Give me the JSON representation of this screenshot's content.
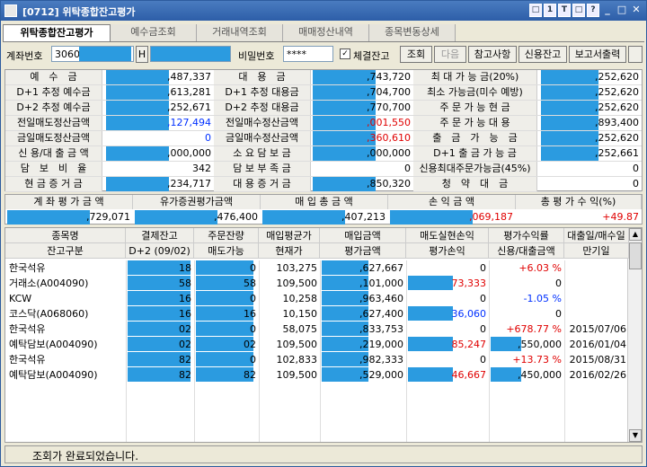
{
  "window": {
    "title": "[0712] 위탁종합잔고평가",
    "title_buttons": [
      "□",
      "1",
      "T",
      "□",
      "?"
    ]
  },
  "tabs": [
    "위탁종합잔고평가",
    "예수금조회",
    "거래내역조회",
    "매매정산내역",
    "종목변동상세"
  ],
  "toolbar": {
    "account_label": "계좌번호",
    "account_value": "3060",
    "account_btn": "H",
    "password_label": "비밀번호",
    "password_value": "****",
    "checkbox_label": "체결잔고",
    "checkbox_mark": "✓",
    "btn_query": "조회",
    "btn_next": "다음",
    "btn_ref": "참고사항",
    "btn_credit": "신용잔고",
    "btn_report": "보고서출력"
  },
  "summary": {
    "rows": [
      [
        "예　수　금",
        ",487,337",
        "대　용　금",
        ",743,720",
        "최 대 가 능 금(20%)",
        ",252,620"
      ],
      [
        "D+1 추정 예수금",
        ",613,281",
        "D+1 추정 대용금",
        ",704,700",
        "최소 가능금(미수 예방)",
        ",252,620"
      ],
      [
        "D+2 추정 예수금",
        ",252,671",
        "D+2 추정 대용금",
        ",770,700",
        "주 문 가 능 현 금",
        ",252,620"
      ],
      [
        "전일매도정산금액",
        ",127,494",
        "전일매수정산금액",
        ",001,550",
        "주 문 가 능 대 용",
        ",893,400"
      ],
      [
        "금일매도정산금액",
        "0",
        "금일매수정산금액",
        ",360,610",
        "출　금　가　능　금",
        ",252,620"
      ],
      [
        "신 용/대 출 금 액",
        ",000,000",
        "소 요 담 보 금",
        ",000,000",
        "D+1 출 금 가 능 금",
        ",252,661"
      ],
      [
        "담　보　비　율",
        "342",
        "담 보 부 족 금",
        "0",
        "신용최대주문가능금(45%)",
        "0"
      ],
      [
        "현 금 증 거 금",
        ",234,717",
        "대 용 증 거 금",
        ",850,320",
        "청　약　대　금",
        "0"
      ]
    ]
  },
  "totals": {
    "headers": [
      "계 좌 평 가 금 액",
      "유가증권평가금액",
      "매 입 총 금 액",
      "손 익 금 액",
      "총 평 가 수 익(%)"
    ],
    "values": [
      ",729,071",
      ",476,400",
      ",407,213",
      ",069,187",
      "+49.87"
    ]
  },
  "grid": {
    "headers1": [
      "종목명",
      "결제잔고",
      "주문잔량",
      "매입평균가",
      "매입금액",
      "매도실현손익",
      "평가수익률",
      "대출일/매수일"
    ],
    "headers2": [
      "잔고구분",
      "D+2 (09/02)",
      "매도가능",
      "현재가",
      "평가금액",
      "평가손익",
      "신용/대출금액",
      "만기일"
    ],
    "rows": [
      [
        "한국석유",
        "18",
        "0",
        "103,275",
        ",627,667",
        "0",
        "+6.03 %",
        ""
      ],
      [
        "거래소(A004090)",
        "58",
        "58",
        "109,500",
        ",101,000",
        "73,333",
        "0",
        ""
      ],
      [
        "KCW",
        "16",
        "0",
        "10,258",
        ",963,460",
        "0",
        "-1.05 %",
        ""
      ],
      [
        "코스닥(A068060)",
        "16",
        "16",
        "10,150",
        ",627,400",
        "36,060",
        "0",
        ""
      ],
      [
        "한국석유",
        "02",
        "0",
        "58,075",
        ",833,753",
        "0",
        "+678.77 %",
        "2015/07/06"
      ],
      [
        "예탁담보(A004090)",
        "02",
        "02",
        "109,500",
        ",219,000",
        "85,247",
        ",550,000",
        "2016/01/04"
      ],
      [
        "한국석유",
        "82",
        "0",
        "102,833",
        ",982,333",
        "0",
        "+13.73 %",
        "2015/08/31"
      ],
      [
        "예탁담보(A004090)",
        "82",
        "82",
        "109,500",
        ",529,000",
        "46,667",
        ",450,000",
        "2016/02/26"
      ]
    ]
  },
  "status": {
    "message": "조회가 완료되었습니다."
  },
  "colors": {
    "accent": "#2b9be0",
    "positive": "#e00000",
    "negative": "#0030ff"
  }
}
